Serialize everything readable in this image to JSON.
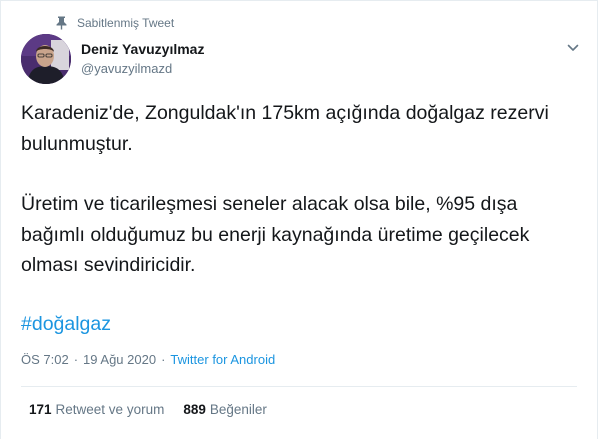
{
  "pinned": {
    "label": "Sabitlenmiş Tweet",
    "icon": "pin-icon"
  },
  "author": {
    "display_name": "Deniz Yavuzyılmaz",
    "handle": "@yavuzyilmazd"
  },
  "menu": {
    "icon": "chevron-down-icon"
  },
  "tweet": {
    "paragraph_1": "Karadeniz'de, Zonguldak'ın 175km açığında doğalgaz rezervi bulunmuştur.",
    "paragraph_2": "Üretim ve ticarileşmesi seneler alacak olsa bile, %95 dışa bağımlı olduğumuz bu enerji kaynağında üretime geçilecek olması sevindiricidir.",
    "hashtag": "#doğalgaz"
  },
  "meta": {
    "time": "ÖS 7:02",
    "separator": "·",
    "date": "19 Ağu 2020",
    "source": "Twitter for Android"
  },
  "stats": {
    "retweets_count": "171",
    "retweets_label": "Retweet ve yorum",
    "likes_count": "889",
    "likes_label": "Beğeniler"
  },
  "colors": {
    "link": "#1b95e0",
    "secondary_text": "#657786",
    "primary_text": "#14171a",
    "border": "#e6ecf0"
  }
}
